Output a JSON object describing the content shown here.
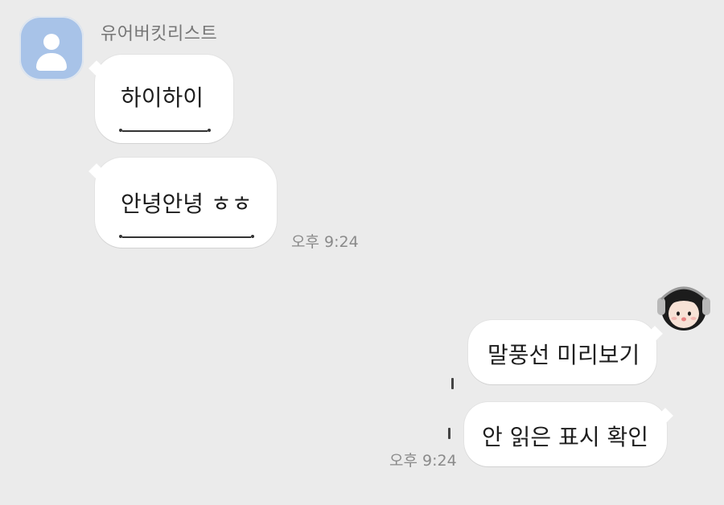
{
  "chat": {
    "friend": {
      "name": "유어버킷리스트",
      "avatar_icon": "default-profile-icon"
    },
    "received": [
      {
        "text": "하이하이"
      },
      {
        "text": "안녕안녕 ㅎㅎ",
        "time": "오후 9:24"
      }
    ],
    "sent": [
      {
        "text": "말풍선 미리보기"
      },
      {
        "text": "안 읽은 표시 확인",
        "time": "오후 9:24"
      }
    ],
    "my_avatar_icon": "girl-with-headphones-icon"
  },
  "colors": {
    "background": "#ebebeb",
    "bubble": "#ffffff",
    "avatar_bg": "#a8c3e8"
  }
}
